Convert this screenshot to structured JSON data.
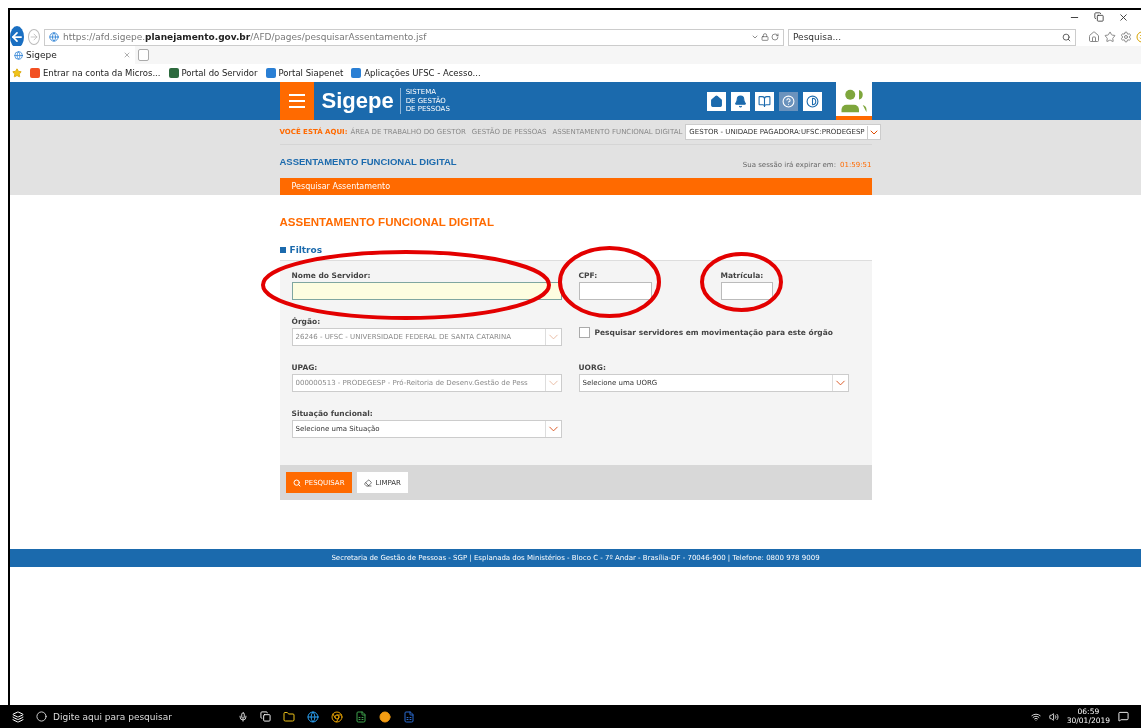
{
  "browser": {
    "url": "https://afd.sigepe.**planejamento.gov.br**/AFD/pages/pesquisarAssentamento.jsf",
    "search_placeholder": "Pesquisa...",
    "tab": "Sigepe",
    "favorites": [
      "Entrar na conta da Micros...",
      "Portal do Servidor",
      "Portal Siapenet",
      "Aplicações UFSC - Acesso..."
    ]
  },
  "header": {
    "logo": "Sigepe",
    "logo_subtitle": [
      "SISTEMA",
      "DE GESTÃO",
      "DE PESSOAS"
    ]
  },
  "breadcrumb": {
    "label": "VOCÊ ESTÁ AQUI:",
    "items": [
      "ÁREA DE TRABALHO DO GESTOR",
      "GESTÃO DE PESSOAS",
      "ASSENTAMENTO FUNCIONAL DIGITAL"
    ],
    "profile": "GESTOR - UNIDADE PAGADORA:UFSC:PRODEGESP"
  },
  "page_title": "ASSENTAMENTO FUNCIONAL DIGITAL",
  "session_label": "Sua sessão irá expirar em:",
  "session_time": "01:59:51",
  "section_tab": "Pesquisar Assentamento",
  "form": {
    "title": "ASSENTAMENTO FUNCIONAL DIGITAL",
    "filters_label": "Filtros",
    "rows": [
      [
        {
          "kind": "text",
          "label": "Nome do Servidor:",
          "focused": true,
          "circled": true
        },
        {
          "kind": "text",
          "label": "CPF:",
          "focused": false,
          "circled": true
        },
        {
          "kind": "text",
          "label": "Matrícula:",
          "focused": false,
          "circled": true
        }
      ],
      [
        {
          "kind": "select",
          "label": "Órgão:",
          "value": "26246 - UFSC - UNIVERSIDADE FEDERAL DE SANTA CATARINA",
          "disabled": true
        },
        {
          "kind": "checkbox",
          "label": "Pesquisar servidores em movimentação para este órgão",
          "checked": false
        }
      ],
      [
        {
          "kind": "select",
          "label": "UPAG:",
          "value": "000000513 - PRODEGESP - Pró-Reitoria de Desenv.Gestão de Pess",
          "disabled": true
        },
        {
          "kind": "select",
          "label": "UORG:",
          "value": "Selecione uma UORG",
          "disabled": false
        }
      ],
      [
        {
          "kind": "select",
          "label": "Situação funcional:",
          "value": "Selecione uma Situação",
          "disabled": false
        }
      ]
    ],
    "buttons": [
      {
        "label": "PESQUISAR",
        "kind": "primary"
      },
      {
        "label": "LIMPAR",
        "kind": "secondary"
      }
    ]
  },
  "footer": "Secretaria de Gestão de Pessoas - SGP | Esplanada dos Ministérios - Bloco C - 7º Andar - Brasília-DF - 70046-900 | Telefone: 0800 978 9009",
  "taskbar": {
    "search_placeholder": "Digite aqui para pesquisar",
    "time": "06:59",
    "date": "30/01/2019"
  }
}
